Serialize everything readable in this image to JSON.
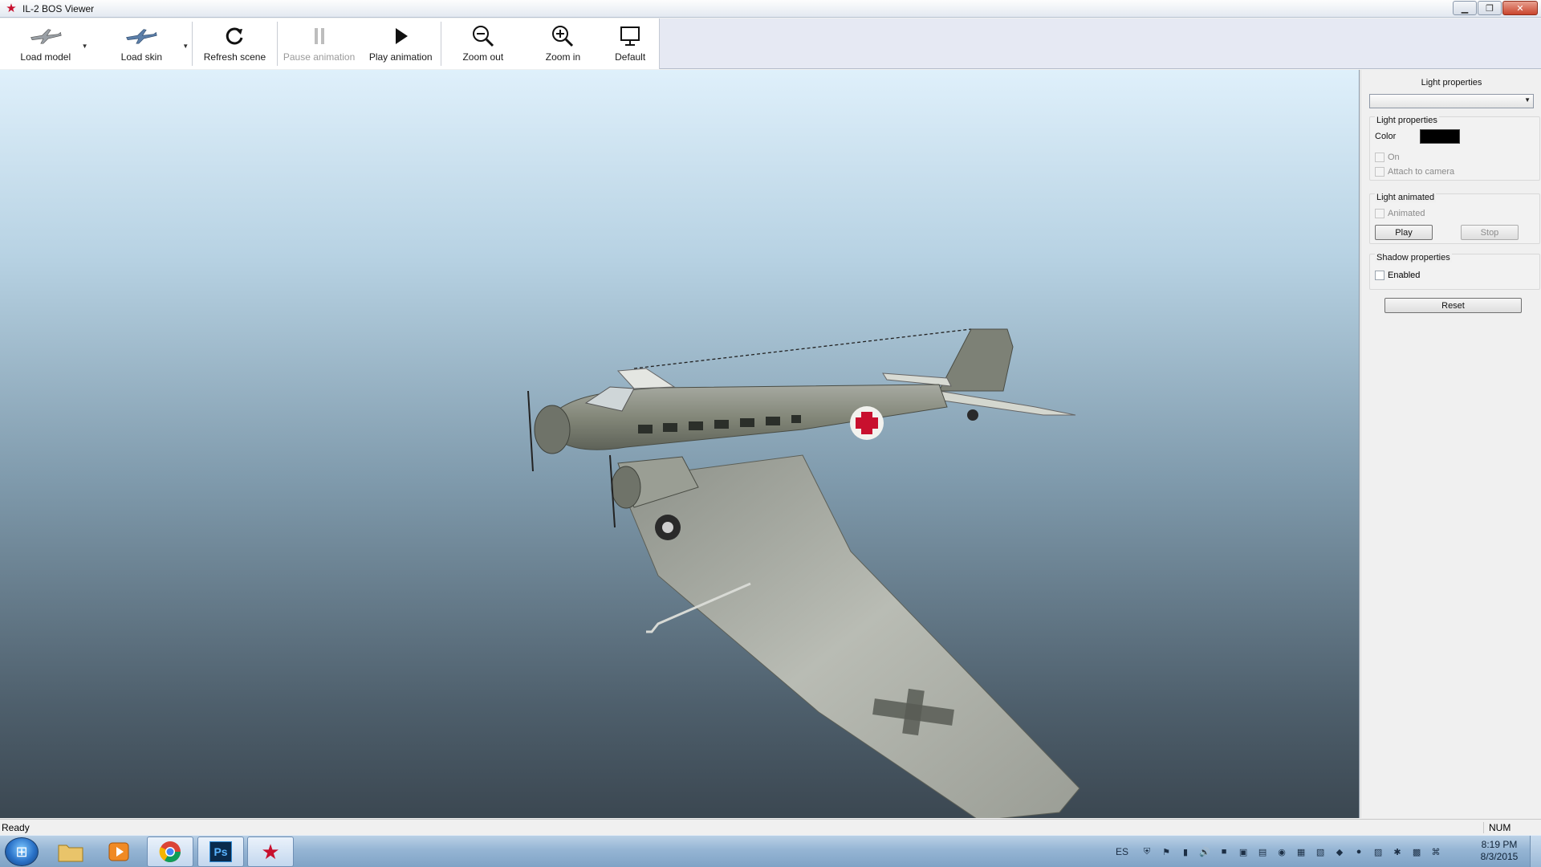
{
  "window": {
    "title": "IL-2 BOS Viewer",
    "minimize_icon": "minimize-icon",
    "maximize_icon": "restore-icon",
    "close_icon": "close-icon"
  },
  "toolbar": {
    "load_model": "Load model",
    "load_skin": "Load skin",
    "refresh_scene": "Refresh scene",
    "pause_animation": "Pause animation",
    "play_animation": "Play animation",
    "zoom_out": "Zoom out",
    "zoom_in": "Zoom in",
    "default": "Default"
  },
  "panel": {
    "title": "Light properties",
    "combo_value": "",
    "light_group": {
      "title": "Light properties",
      "color_label": "Color",
      "color_value": "#000000",
      "on_label": "On",
      "attach_label": "Attach to camera"
    },
    "animated_group": {
      "title": "Light animated",
      "animated_label": "Animated",
      "play_label": "Play",
      "stop_label": "Stop"
    },
    "shadow_group": {
      "title": "Shadow properties",
      "enabled_label": "Enabled"
    },
    "reset_label": "Reset"
  },
  "status": {
    "text": "Ready",
    "num": "NUM"
  },
  "taskbar": {
    "lang": "ES",
    "time": "8:19 PM",
    "date": "8/3/2015",
    "ps_label": "Ps"
  }
}
